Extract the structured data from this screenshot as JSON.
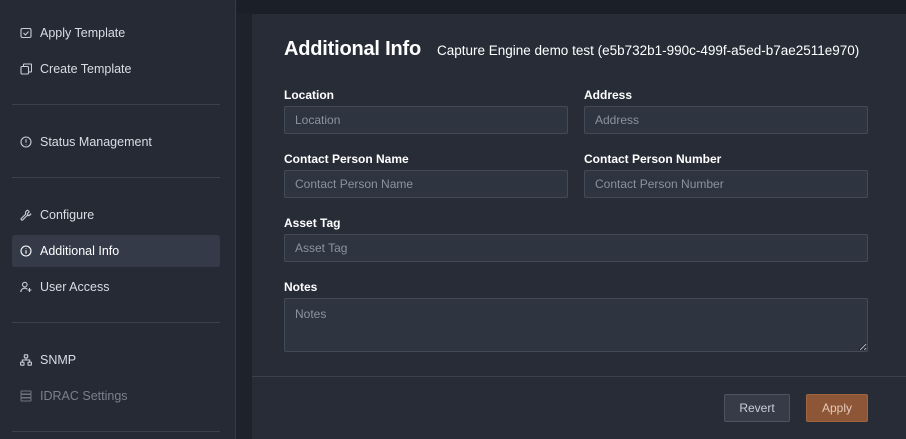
{
  "sidebar": {
    "items": [
      {
        "label": "Apply Template",
        "icon": "apply-template-icon"
      },
      {
        "label": "Create Template",
        "icon": "copy-icon"
      },
      {
        "label": "Status Management",
        "icon": "info-circle-icon"
      },
      {
        "label": "Configure",
        "icon": "wrench-icon"
      },
      {
        "label": "Additional Info",
        "icon": "info-circle-icon",
        "active": true
      },
      {
        "label": "User Access",
        "icon": "user-plus-icon"
      },
      {
        "label": "SNMP",
        "icon": "network-icon"
      },
      {
        "label": "IDRAC Settings",
        "icon": "server-icon",
        "disabled": true
      }
    ]
  },
  "panel": {
    "title": "Additional Info",
    "subtitle": "Capture Engine demo test (e5b732b1-990c-499f-a5ed-b7ae2511e970)"
  },
  "form": {
    "location": {
      "label": "Location",
      "placeholder": "Location",
      "value": ""
    },
    "address": {
      "label": "Address",
      "placeholder": "Address",
      "value": ""
    },
    "contact_name": {
      "label": "Contact Person Name",
      "placeholder": "Contact Person Name",
      "value": ""
    },
    "contact_number": {
      "label": "Contact Person Number",
      "placeholder": "Contact Person Number",
      "value": ""
    },
    "asset_tag": {
      "label": "Asset Tag",
      "placeholder": "Asset Tag",
      "value": ""
    },
    "notes": {
      "label": "Notes",
      "placeholder": "Notes",
      "value": ""
    }
  },
  "actions": {
    "revert_label": "Revert",
    "apply_label": "Apply"
  },
  "colors": {
    "accent": "#8d5637",
    "background": "#1e222b",
    "panel": "#272c37"
  }
}
